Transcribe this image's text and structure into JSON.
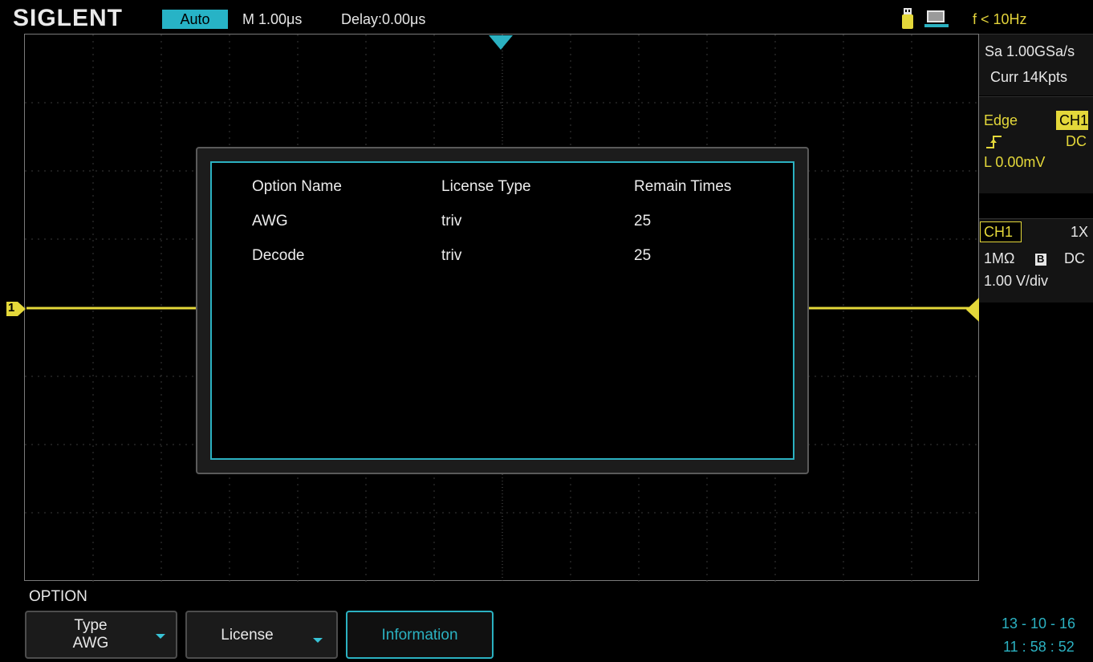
{
  "top_bar": {
    "brand": "SIGLENT",
    "trigger_mode": "Auto",
    "timebase": "M 1.00μs",
    "delay": "Delay:0.00μs",
    "frequency": "f < 10Hz"
  },
  "acquisition": {
    "sample_rate": "Sa 1.00GSa/s",
    "memory_depth": "Curr 14Kpts"
  },
  "trigger": {
    "type": "Edge",
    "source": "CH1",
    "coupling": "DC",
    "level": "L  0.00mV"
  },
  "channel": {
    "name": "CH1",
    "probe": "1X",
    "impedance": "1MΩ",
    "bw_limit": "B",
    "coupling": "DC",
    "scale": "1.00 V/div"
  },
  "marker": {
    "channel_label": "1"
  },
  "dialog": {
    "headers": [
      "Option Name",
      "License Type",
      "Remain Times"
    ],
    "rows": [
      [
        "AWG",
        "triv",
        "25"
      ],
      [
        "Decode",
        "triv",
        "25"
      ]
    ]
  },
  "menu": {
    "title": "OPTION",
    "type_label": "Type",
    "type_value": "AWG",
    "license_label": "License",
    "information_label": "Information"
  },
  "clock": {
    "date": "13 - 10 - 16",
    "time": "11 : 58 : 52"
  },
  "colors": {
    "trace": "#e4d83a",
    "accent": "#27b3c6",
    "grid": "#7a7a7a"
  }
}
